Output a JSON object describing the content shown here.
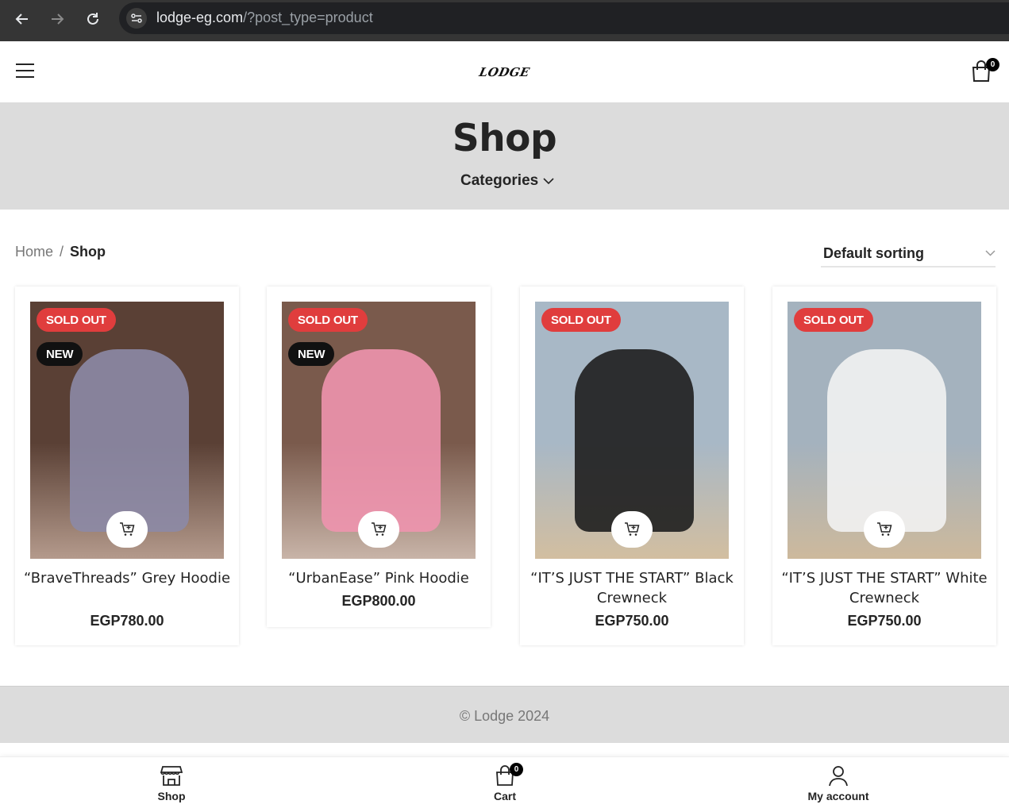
{
  "browser": {
    "url_host": "lodge-eg.com",
    "url_path": "/?post_type=product"
  },
  "header": {
    "logo_text": "LODGE",
    "cart_count": "0"
  },
  "title_band": {
    "title": "Shop",
    "categories_label": "Categories"
  },
  "breadcrumb": {
    "home": "Home",
    "separator": "/",
    "current": "Shop"
  },
  "sorting": {
    "selected": "Default sorting"
  },
  "products": [
    {
      "title": "“BraveThreads” Grey Hoodie",
      "price": "EGP780.00",
      "badges": [
        "SOLD OUT",
        "NEW"
      ],
      "image_colors": [
        "#5a4035",
        "#8c8aa6",
        "#b49a8c"
      ]
    },
    {
      "title": "“UrbanEase” Pink Hoodie",
      "price": "EGP800.00",
      "badges": [
        "SOLD OUT",
        "NEW"
      ],
      "image_colors": [
        "#7a5a4c",
        "#ee93ae",
        "#c8b4a8"
      ]
    },
    {
      "title": "“IT’S JUST THE START” Black Crewneck",
      "price": "EGP750.00",
      "badges": [
        "SOLD OUT"
      ],
      "image_colors": [
        "#a8b8c6",
        "#1e1e1e",
        "#d2bea0"
      ]
    },
    {
      "title": "“IT’S JUST THE START” White Crewneck",
      "price": "EGP750.00",
      "badges": [
        "SOLD OUT"
      ],
      "image_colors": [
        "#a4b2be",
        "#f2f2f2",
        "#cdb99c"
      ]
    }
  ],
  "footer": {
    "copyright": "© Lodge 2024"
  },
  "toolbar": {
    "shop_label": "Shop",
    "cart_label": "Cart",
    "cart_count": "0",
    "account_label": "My account"
  },
  "colors": {
    "sold_out_badge": "#e03d3d",
    "new_badge": "#111111",
    "band_background": "#dcdcdc"
  }
}
